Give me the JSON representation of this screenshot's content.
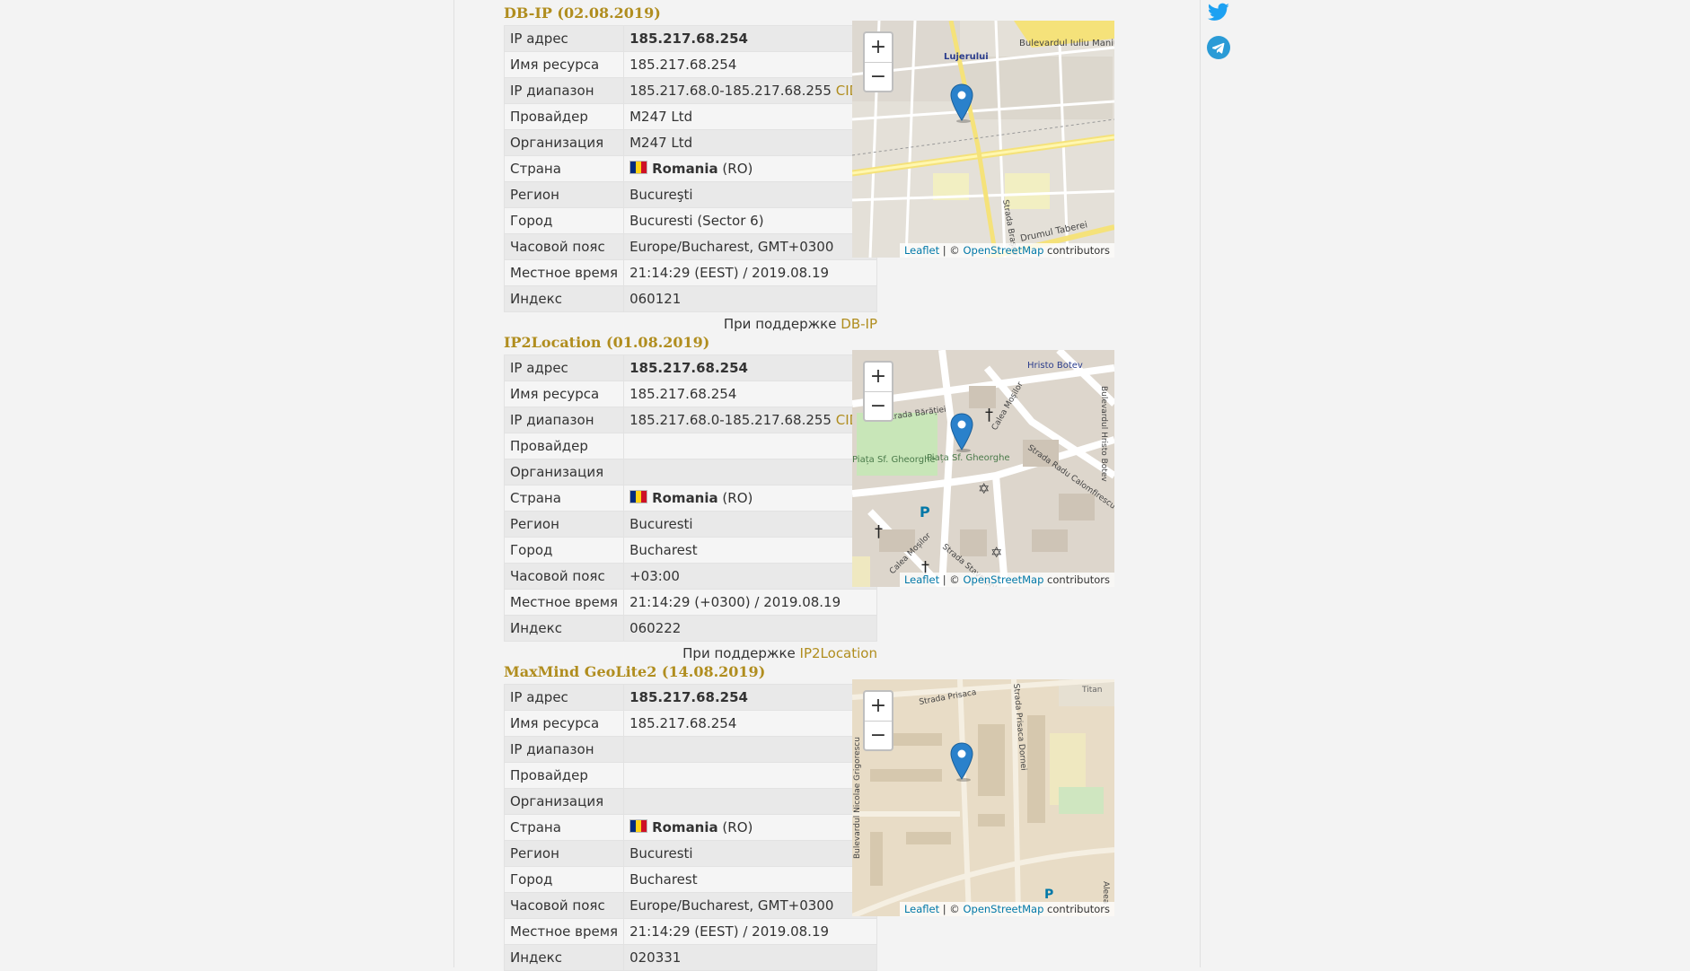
{
  "sections": [
    {
      "title": "DB-IP (02.08.2019)",
      "rows": [
        {
          "label": "IP адрес",
          "value": "185.217.68.254"
        },
        {
          "label": "Имя ресурса",
          "value": "185.217.68.254"
        },
        {
          "label": "IP диапазон",
          "value": "185.217.68.0-185.217.68.255",
          "link": "CIDR"
        },
        {
          "label": "Провайдер",
          "value": "M247 Ltd"
        },
        {
          "label": "Организация",
          "value": "M247 Ltd"
        },
        {
          "label": "Страна",
          "country": "Romania",
          "code": "(RO)"
        },
        {
          "label": "Регион",
          "value": "Bucureşti"
        },
        {
          "label": "Город",
          "value": "Bucuresti (Sector 6)"
        },
        {
          "label": "Часовой пояс",
          "value": "Europe/Bucharest, GMT+0300"
        },
        {
          "label": "Местное время",
          "value": "21:14:29 (EEST) / 2019.08.19"
        },
        {
          "label": "Индекс",
          "value": "060121"
        }
      ],
      "supported_prefix": "При поддержке",
      "supported_link": "DB-IP"
    },
    {
      "title": "IP2Location (01.08.2019)",
      "rows": [
        {
          "label": "IP адрес",
          "value": "185.217.68.254"
        },
        {
          "label": "Имя ресурса",
          "value": "185.217.68.254"
        },
        {
          "label": "IP диапазон",
          "value": "185.217.68.0-185.217.68.255",
          "link": "CIDR"
        },
        {
          "label": "Провайдер",
          "value": ""
        },
        {
          "label": "Организация",
          "value": ""
        },
        {
          "label": "Страна",
          "country": "Romania",
          "code": "(RO)"
        },
        {
          "label": "Регион",
          "value": "Bucuresti"
        },
        {
          "label": "Город",
          "value": "Bucharest"
        },
        {
          "label": "Часовой пояс",
          "value": "+03:00"
        },
        {
          "label": "Местное время",
          "value": "21:14:29 (+0300) / 2019.08.19"
        },
        {
          "label": "Индекс",
          "value": "060222"
        }
      ],
      "supported_prefix": "При поддержке",
      "supported_link": "IP2Location"
    },
    {
      "title": "MaxMind GeoLite2 (14.08.2019)",
      "rows": [
        {
          "label": "IP адрес",
          "value": "185.217.68.254"
        },
        {
          "label": "Имя ресурса",
          "value": "185.217.68.254"
        },
        {
          "label": "IP диапазон",
          "value": ""
        },
        {
          "label": "Провайдер",
          "value": ""
        },
        {
          "label": "Организация",
          "value": ""
        },
        {
          "label": "Страна",
          "country": "Romania",
          "code": "(RO)"
        },
        {
          "label": "Регион",
          "value": "Bucuresti"
        },
        {
          "label": "Город",
          "value": "Bucharest"
        },
        {
          "label": "Часовой пояс",
          "value": "Europe/Bucharest, GMT+0300"
        },
        {
          "label": "Местное время",
          "value": "21:14:29 (EEST) / 2019.08.19"
        },
        {
          "label": "Индекс",
          "value": "020331"
        }
      ]
    }
  ],
  "map": {
    "zoom_in": "+",
    "zoom_out": "−",
    "attr_leaflet": "Leaflet",
    "attr_sep": " | © ",
    "attr_osm": "OpenStreetMap",
    "attr_contributors": " contributors",
    "labels": [
      [
        "Bulevardul Iuliu Maniu",
        "Lujerului",
        "Strada Brașov",
        "Drumul Taberei"
      ],
      [
        "Hristo Botev",
        "Strada Bărăției",
        "Piața Sf. Gheorghe",
        "Strada Radu Calomfirescu",
        "Calea Moșilor",
        "Bulevardul Hristo Botev",
        "Piața Sf. Gheorghe",
        "Calea Moșilor",
        "Strada Stavropoleos"
      ],
      [
        "Strada Prisaca",
        "Strada Prisaca Dornei",
        "Titan",
        "Bulevardul Nicolae Grigorescu",
        "Aleea"
      ]
    ]
  },
  "colors": {
    "accent": "#b08d1e",
    "marker": "#2a81cb",
    "link_blue": "#0078a8"
  },
  "social": [
    "twitter-icon",
    "telegram-icon"
  ]
}
